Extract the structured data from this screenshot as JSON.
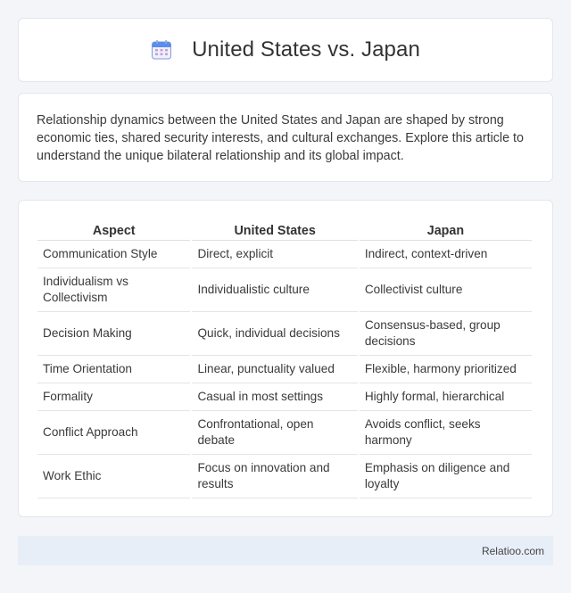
{
  "header": {
    "title": "United States vs. Japan",
    "icon": "calendar-icon"
  },
  "intro": {
    "text": "Relationship dynamics between the United States and Japan are shaped by strong economic ties, shared security interests, and cultural exchanges. Explore this article to understand the unique bilateral relationship and its global impact."
  },
  "table": {
    "headers": [
      "Aspect",
      "United States",
      "Japan"
    ],
    "rows": [
      [
        "Communication Style",
        "Direct, explicit",
        "Indirect, context-driven"
      ],
      [
        "Individualism vs Collectivism",
        "Individualistic culture",
        "Collectivist culture"
      ],
      [
        "Decision Making",
        "Quick, individual decisions",
        "Consensus-based, group decisions"
      ],
      [
        "Time Orientation",
        "Linear, punctuality valued",
        "Flexible, harmony prioritized"
      ],
      [
        "Formality",
        "Casual in most settings",
        "Highly formal, hierarchical"
      ],
      [
        "Conflict Approach",
        "Confrontational, open debate",
        "Avoids conflict, seeks harmony"
      ],
      [
        "Work Ethic",
        "Focus on innovation and results",
        "Emphasis on diligence and loyalty"
      ]
    ]
  },
  "footer": {
    "brand": "Relatioo.com"
  },
  "colors": {
    "page_background": "#f3f5f9",
    "footer_background": "#e8eef8",
    "icon_accent": "#5b8def"
  }
}
